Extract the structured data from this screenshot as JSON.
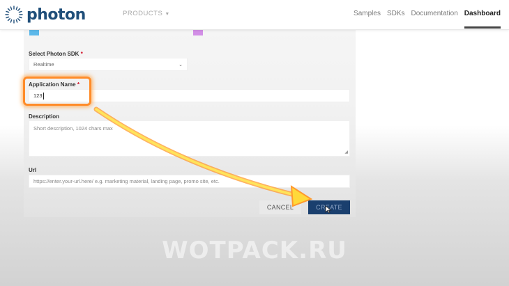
{
  "navbar": {
    "logo_text": "photon",
    "products_label": "PRODUCTS",
    "links": [
      "Samples",
      "SDKs",
      "Documentation",
      "Dashboard"
    ],
    "active_link": "Dashboard"
  },
  "form": {
    "sdk": {
      "label": "Select Photon SDK",
      "required_mark": "*",
      "selected": "Realtime"
    },
    "app_name": {
      "label": "Application Name",
      "required_mark": "*",
      "value": "123"
    },
    "description": {
      "label": "Description",
      "placeholder": "Short description, 1024 chars max"
    },
    "url": {
      "label": "Url",
      "placeholder": "https://enter.your-url.here/ e.g. marketing material, landing page, promo site, etc."
    },
    "buttons": {
      "cancel": "CANCEL",
      "create": "CREATE"
    }
  },
  "watermark": "WOTPACK.RU",
  "colors": {
    "brand": "#1f4e79",
    "create_button": "#1a3f6e",
    "highlight": "#ff8c2a",
    "arrow": "#ffd93a",
    "swatch_blue": "#5cb8ea",
    "swatch_purple": "#d28ee6"
  }
}
